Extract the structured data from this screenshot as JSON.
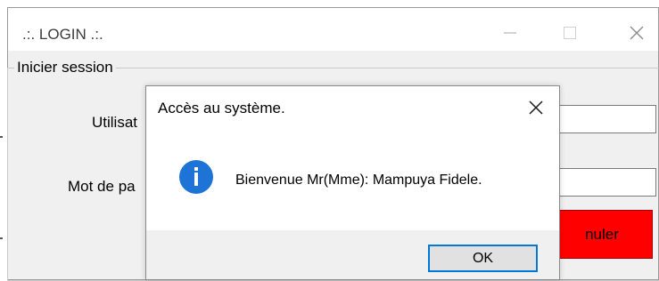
{
  "main_window": {
    "title": ".:. LOGIN .:.",
    "group_title": "Inicier session",
    "user_label_visible": "Utilisat",
    "password_label_visible": "Mot de pa",
    "cancel_button_visible": "nuler",
    "cancel_color": "#ff0000"
  },
  "dialog": {
    "title": "Accès au système.",
    "message": "Bienvenue Mr(Mme): Mampuya Fidele.",
    "ok_label": "OK",
    "icon": "info-icon",
    "accent": "#0078d7"
  }
}
